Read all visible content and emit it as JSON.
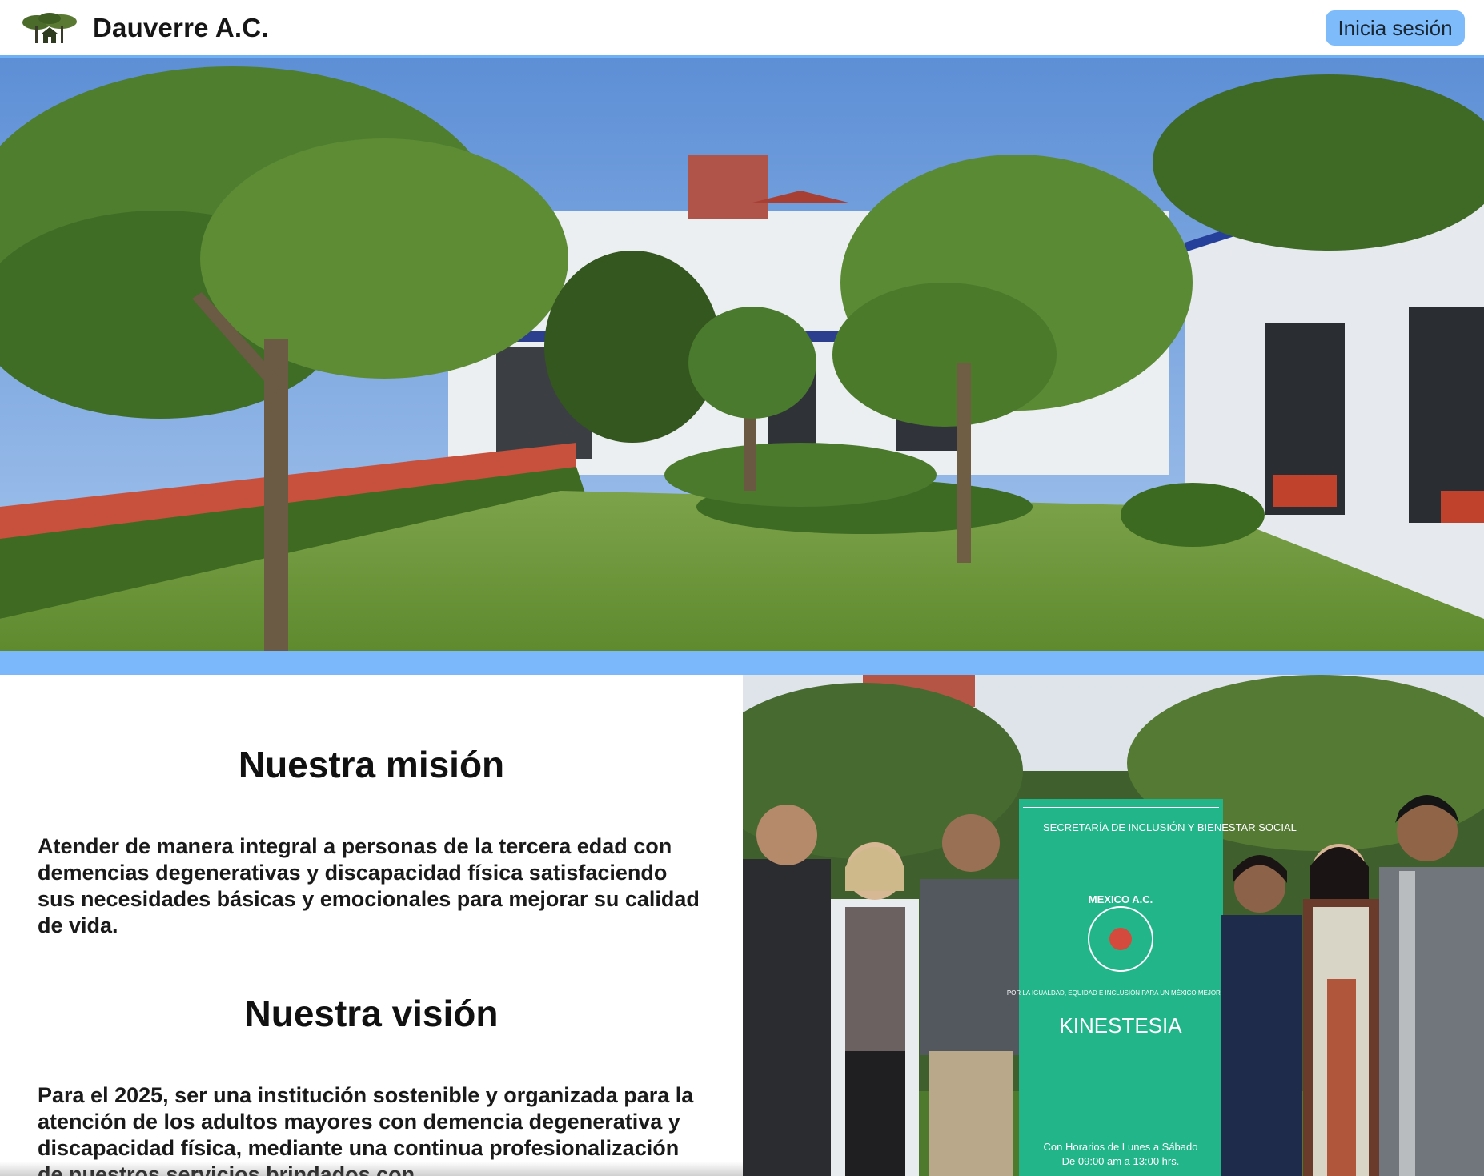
{
  "header": {
    "brand": "Dauverre A.C.",
    "login_label": "Inicia sesión",
    "logo_icon": "tree-house-logo-icon"
  },
  "hero": {
    "image": "garden-courtyard-photo"
  },
  "mission": {
    "title": "Nuestra misión",
    "text": "Atender de manera integral a personas de la tercera edad con demencias degenerativas y discapacidad física satisfaciendo sus necesidades básicas y emocionales para mejorar su calidad de vida."
  },
  "vision": {
    "title": "Nuestra visión",
    "text": "Para el 2025, ser una institución sostenible y organizada para la atención de los adultos mayores con demencia degenerativa y discapacidad física, mediante una continua profesionalización de nuestros servicios brindados con"
  },
  "group_photo": {
    "banner": {
      "agency": "SECRETARÍA DE INCLUSIÓN Y BIENESTAR SOCIAL",
      "org": "MEXICO A.C.",
      "slogan": "POR LA IGUALDAD, EQUIDAD E INCLUSIÓN PARA UN MÉXICO MEJOR A.C.",
      "title": "KINESTESIA",
      "hours_line1": "Con Horarios de Lunes a Sábado",
      "hours_line2": "De 09:00 am a 13:00 hrs."
    }
  },
  "colors": {
    "accent": "#7ab8fb",
    "button": "#7dbbfb"
  }
}
